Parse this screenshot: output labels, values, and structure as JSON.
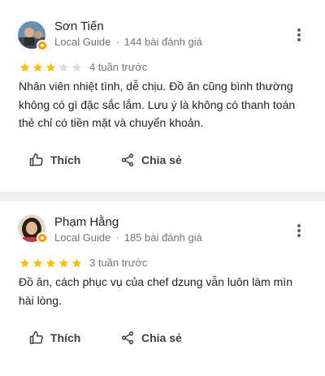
{
  "colors": {
    "star_filled": "#fbbc04",
    "star_empty": "#dadce0",
    "local_guide_badge": "#f29900"
  },
  "reviews": [
    {
      "name": "Sơn Tiến",
      "guide_label": "Local Guide",
      "separator": "·",
      "reviews_count": "144 bài đánh giá",
      "rating": 3,
      "max_rating": 5,
      "time": "4 tuần trước",
      "lines": [
        "Nhân viên nhiệt tình, dễ chịu. Đồ ăn cũng bình thường",
        "không có gì đặc sắc lắm. Lưu ý là không có thanh toán",
        "thẻ chỉ có tiền mặt và chuyển khoản."
      ],
      "like_label": "Thích",
      "share_label": "Chia sẻ"
    },
    {
      "name": "Phạm Hằng",
      "guide_label": "Local Guide",
      "separator": "·",
      "reviews_count": "185 bài đánh giá",
      "rating": 5,
      "max_rating": 5,
      "time": "3 tuần trước",
      "lines": [
        "Đồ ăn, cách phục vụ của chef dzung vẫn luôn làm mìn",
        "hài lòng."
      ],
      "like_label": "Thích",
      "share_label": "Chia sẻ"
    }
  ]
}
